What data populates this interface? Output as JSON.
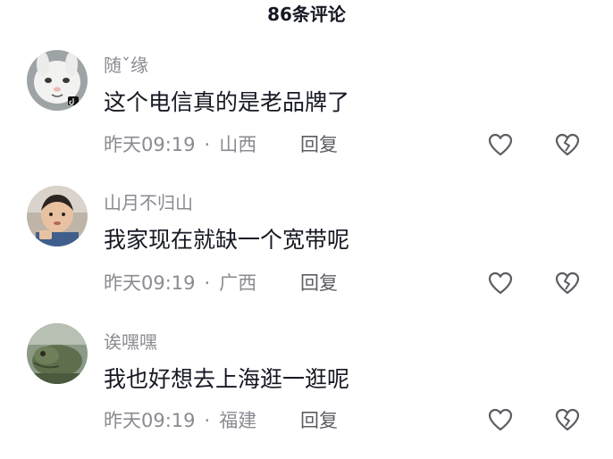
{
  "header": {
    "title": "86条评论"
  },
  "comments": [
    {
      "username": "随ˇ缘",
      "content": "这个电信真的是老品牌了",
      "time": "昨天09:19",
      "separator": "·",
      "location": "山西",
      "reply_label": "回复",
      "avatar_icon": "cartoon-rabbit-avatar",
      "like_icon": "heart-outline-icon",
      "dislike_icon": "broken-heart-icon"
    },
    {
      "username": "山月不归山",
      "content": "我家现在就缺一个宽带呢",
      "time": "昨天09:19",
      "separator": "·",
      "location": "广西",
      "reply_label": "回复",
      "avatar_icon": "child-photo-avatar",
      "like_icon": "heart-outline-icon",
      "dislike_icon": "broken-heart-icon"
    },
    {
      "username": "诶嘿嘿",
      "content": "我也好想去上海逛一逛呢",
      "time": "昨天09:19",
      "separator": "·",
      "location": "福建",
      "reply_label": "回复",
      "avatar_icon": "iguana-photo-avatar",
      "like_icon": "heart-outline-icon",
      "dislike_icon": "broken-heart-icon"
    }
  ],
  "colors": {
    "primary_text": "#161823",
    "secondary_text": "#8a8b91",
    "icon": "#5c5d63",
    "background": "#ffffff"
  }
}
